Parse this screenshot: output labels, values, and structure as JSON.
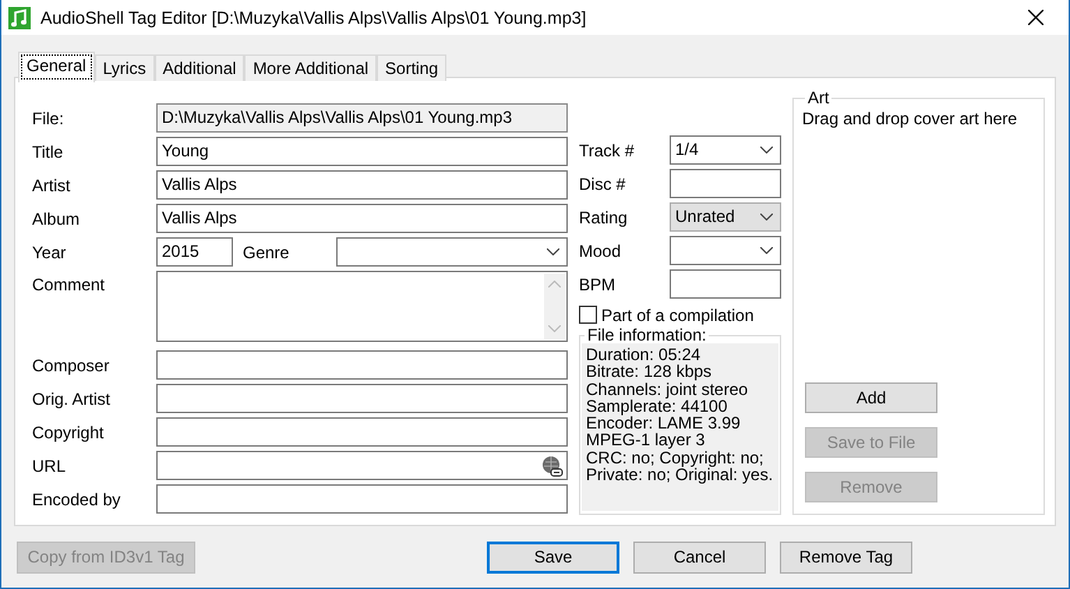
{
  "window": {
    "title": "AudioShell Tag Editor [D:\\Muzyka\\Vallis Alps\\Vallis Alps\\01 Young.mp3]"
  },
  "tabs": [
    {
      "label": "General",
      "selected": true
    },
    {
      "label": "Lyrics",
      "selected": false
    },
    {
      "label": "Additional",
      "selected": false
    },
    {
      "label": "More Additional",
      "selected": false
    },
    {
      "label": "Sorting",
      "selected": false
    }
  ],
  "file": {
    "label": "File:",
    "value": "D:\\Muzyka\\Vallis Alps\\Vallis Alps\\01 Young.mp3"
  },
  "fields_top": [
    {
      "label": "Title",
      "value": "Young"
    },
    {
      "label": "Artist",
      "value": "Vallis Alps"
    },
    {
      "label": "Album",
      "value": "Vallis Alps"
    }
  ],
  "year": {
    "label": "Year",
    "value": "2015"
  },
  "genre": {
    "label": "Genre"
  },
  "comment": {
    "label": "Comment"
  },
  "fields_bottom": [
    {
      "label": "Composer",
      "kind": "text"
    },
    {
      "label": "Orig. Artist",
      "kind": "text"
    },
    {
      "label": "Copyright",
      "kind": "text"
    },
    {
      "label": "URL",
      "kind": "link"
    },
    {
      "label": "Encoded by",
      "kind": "text"
    }
  ],
  "side_fields": [
    {
      "label": "Track #",
      "kind": "combo",
      "value": "1/4"
    },
    {
      "label": "Disc #",
      "kind": "text"
    },
    {
      "label": "Rating",
      "kind": "list",
      "value": "Unrated"
    },
    {
      "label": "Mood",
      "kind": "combo"
    },
    {
      "label": "BPM",
      "kind": "text"
    }
  ],
  "compilation": {
    "label": "Part of a compilation",
    "checked": false
  },
  "file_info": {
    "title": "File information:",
    "lines": [
      "Duration: 05:24",
      "Bitrate: 128 kbps",
      "Channels: joint stereo",
      "Samplerate: 44100",
      "Encoder: LAME 3.99",
      "MPEG-1 layer 3",
      "CRC: no; Copyright: no;",
      "Private: no; Original: yes."
    ]
  },
  "art": {
    "title": "Art",
    "hint": "Drag and drop cover art here",
    "buttons": [
      {
        "label": "Add",
        "disabled": false
      },
      {
        "label": "Save to File",
        "disabled": true
      },
      {
        "label": "Remove",
        "disabled": true
      }
    ]
  },
  "bottom_buttons": [
    {
      "label": "Copy from ID3v1 Tag",
      "disabled": true,
      "default": false
    },
    {
      "label": "Save",
      "disabled": false,
      "default": true
    },
    {
      "label": "Cancel",
      "disabled": false,
      "default": false
    },
    {
      "label": "Remove Tag",
      "disabled": false,
      "default": false
    }
  ]
}
